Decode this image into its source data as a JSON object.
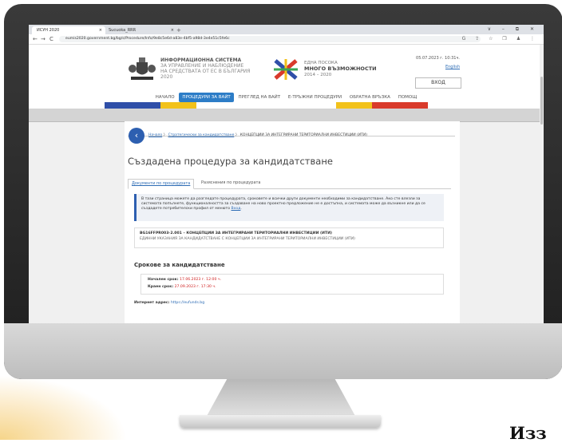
{
  "browser": {
    "tabs": [
      {
        "label": "ИСУН 2020",
        "close": "×"
      },
      {
        "label": "Sucuoka_RRR",
        "close": "×"
      }
    ],
    "new_tab": "+",
    "window_controls": "∨ – ⧉ ✕",
    "nav": {
      "back": "←",
      "forward": "→",
      "reload": "C"
    },
    "url": "eumis2020.government.bg/bg/s/Procedure/Info/9e8c5e6d-a83e-4bf5-a98d-3e4e51c5fe6c",
    "ext_icons": "G ⇪ ☆ ❒ ♟ ⋮"
  },
  "header": {
    "system_title_lines": [
      "ИНФОРМАЦИОННА СИСТЕМА",
      "ЗА УПРАВЛЕНИЕ И НАБЛЮДЕНИЕ",
      "НА СРЕДСТВАТА ОТ ЕС В БЪЛГАРИЯ",
      "2020"
    ],
    "eu_lines": [
      "ЕДНА ПОСОКА",
      "МНОГО ВЪЗМОЖНОСТИ",
      "2014 – 2020"
    ],
    "date": "05.07.2023 г. 10:31ч.",
    "language": "English",
    "login": "ВХОД"
  },
  "main_nav": [
    {
      "label": "НАЧАЛО",
      "active": false
    },
    {
      "label": "ПРОЦЕДУРИ ЗА ВАЙТ",
      "active": true
    },
    {
      "label": "ПРЕГЛЕД НА ВАЙТ",
      "active": false
    },
    {
      "label": "Е-ТРЪЖНИ ПРОЦЕДУРИ",
      "active": false
    },
    {
      "label": "ОБРАТНА ВРЪЗКА",
      "active": false
    },
    {
      "label": "ПОМОЩ",
      "active": false
    }
  ],
  "colors": {
    "accent": "#2d7dc7",
    "back_button": "#2d5fb0",
    "deadline_red": "#d02020",
    "stripe_blue": "#2f4fa8",
    "stripe_yellow": "#f2c21b",
    "stripe_red": "#d93a2b"
  },
  "breadcrumb": {
    "items": [
      "Начало",
      "Стратегически за кандидатстване"
    ],
    "current": "КОНЦЕПЦИИ ЗА ИНТЕГРИРАНИ ТЕРИТОРИАЛНИ ИНВЕСТИЦИИ (ИТИ)"
  },
  "page_title": "Създадена процедура за кандидатстване",
  "tabs": [
    "Документи по процедурата",
    "Разяснения по процедурата"
  ],
  "info": {
    "text": "В тази страница можете да разгледате процедурата, сроковете и всички други документи необходими за кандидатстване. Ако сте влезли за системата попълнете, функционалността за създаване на ново проектно предложение не е достъпна, и системата може да възникне или да се създадете потребителски профил от менюто",
    "link": "Вход"
  },
  "procedure": {
    "code": "BG16FFPR003-2.001 – КОНЦЕПЦИИ ЗА ИНТЕГРИРАНИ ТЕРИТОРИАЛНИ ИНВЕСТИЦИИ (ИТИ)",
    "subtitle": "ЕДИННИ УКАЗАНИЯ ЗА КАНДИДАТСТВАНЕ С КОНЦЕПЦИИ ЗА ИНТЕГРИРАНИ ТЕРИТОРИАЛНИ ИНВЕСТИЦИИ (ИТИ)"
  },
  "deadlines": {
    "title": "Срокове за кандидатстване",
    "start_label": "Начален срок:",
    "start_value": "17.06.2023 г. 12:00 ч.",
    "end_label": "Краен срок:",
    "end_value": "27.09.2023 г. 17:30 ч."
  },
  "internet": {
    "label": "Интернет адрес:",
    "value": "https://eufunds.bg"
  },
  "corner_text": "Изз"
}
